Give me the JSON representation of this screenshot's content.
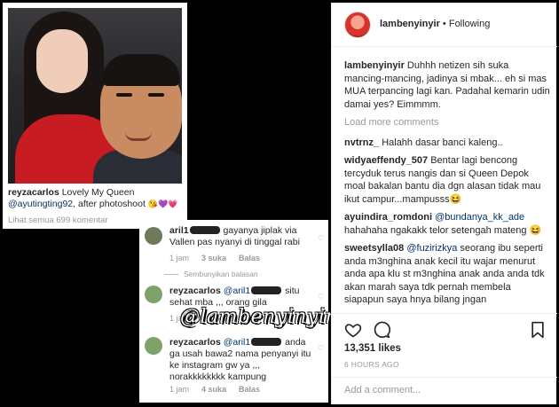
{
  "photo_post": {
    "caption_user": "reyzacarlos",
    "caption_text_1": "Lovely My Queen",
    "mention": "@ayutingting92",
    "caption_text_2": ", after photoshoot",
    "emojis": "😘💜💗",
    "view_all": "Lihat semua 699 komentar"
  },
  "comment_thread": [
    {
      "user": "aril1",
      "text": "gayanya jiplak via Vallen pas nyanyi di tinggal rabi",
      "time": "1 jam",
      "likes": "3 suka",
      "reply": "Balas"
    },
    {
      "user": "reyzacarlos",
      "mention": "@aril1",
      "text": "situ sehat mba ,,, orang gila",
      "time": "1 jam",
      "likes": "3 suka",
      "reply": "Balas"
    },
    {
      "user": "reyzacarlos",
      "mention": "@aril1",
      "text": "anda ga usah bawa2 nama penyanyi itu ke instagram gw ya ,,, norakkkkkkkk kampung",
      "time": "1 jam",
      "likes": "4 suka",
      "reply": "Balas"
    }
  ],
  "hide_replies": "Sembunyikan balasan",
  "watermark": "@lambenyinyir",
  "ig": {
    "username": "lambenyinyir",
    "following": "Following",
    "caption_user": "lambenyinyir",
    "caption": "Duhhh netizen sih suka mancing-mancing, jadinya si mbak... eh si mas MUA terpancing lagi kan. Padahal kemarin udin damai yes? Eimmmm.",
    "load_more": "Load more comments",
    "comments": [
      {
        "user": "nvtrnz_",
        "mention": "",
        "text": "Halahh dasar banci kaleng.."
      },
      {
        "user": "widyaeffendy_507",
        "mention": "",
        "text": "Bentar lagi bencong tercyduk terus nangis dan si Queen Depok moal bakalan bantu dia dgn alasan tidak mau ikut campur...mampusss😆"
      },
      {
        "user": "ayuindira_romdoni",
        "mention": "@bundanya_kk_ade",
        "text": "hahahaha ngakakk telor setengah mateng 😆"
      },
      {
        "user": "sweetsylla08",
        "mention": "@fuzirizkya",
        "text": "seorang ibu seperti anda m3nghina anak kecil itu wajar menurut anda apa klu st m3nghina anak anda anda tdk akan marah saya tdk pernah membela siapapun saya hnya bilang jngan"
      }
    ],
    "likes": "13,351 likes",
    "time": "6 HOURS AGO",
    "add_comment_placeholder": "Add a comment..."
  },
  "colors": {
    "link": "#003569",
    "muted": "#999999",
    "background": "#000000"
  }
}
